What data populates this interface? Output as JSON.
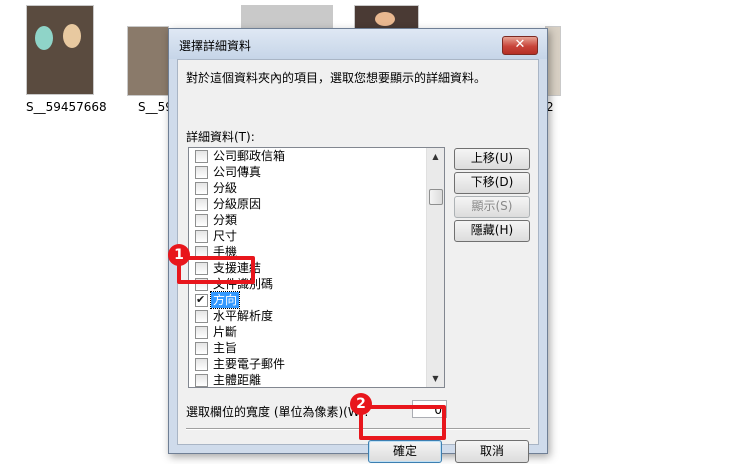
{
  "background_files": {
    "names": [
      "S__59457668",
      "S__59",
      "2"
    ]
  },
  "dialog": {
    "title": "選擇詳細資料",
    "close_glyph": "✕",
    "description": "對於這個資料夾內的項目，選取您想要顯示的詳細資料。",
    "list_label": "詳細資料(T):",
    "items": [
      {
        "label": "公司郵政信箱",
        "checked": false
      },
      {
        "label": "公司傳真",
        "checked": false
      },
      {
        "label": "分級",
        "checked": false
      },
      {
        "label": "分級原因",
        "checked": false
      },
      {
        "label": "分類",
        "checked": false
      },
      {
        "label": "尺寸",
        "checked": false
      },
      {
        "label": "手機",
        "checked": false
      },
      {
        "label": "支援連結",
        "checked": false
      },
      {
        "label": "文件識別碼",
        "checked": false
      },
      {
        "label": "方向",
        "checked": true,
        "selected": true
      },
      {
        "label": "水平解析度",
        "checked": false
      },
      {
        "label": "片斷",
        "checked": false
      },
      {
        "label": "主旨",
        "checked": false
      },
      {
        "label": "主要電子郵件",
        "checked": false
      },
      {
        "label": "主體距離",
        "checked": false
      }
    ],
    "side_buttons": {
      "move_up": "上移(U)",
      "move_down": "下移(D)",
      "show": "顯示(S)",
      "hide": "隱藏(H)"
    },
    "width_label": "選取欄位的寬度 (單位為像素)(W):",
    "width_value": "0",
    "ok_label": "確定",
    "cancel_label": "取消"
  },
  "annotations": {
    "badge1": "1",
    "badge2": "2",
    "color": "#e8161c"
  }
}
